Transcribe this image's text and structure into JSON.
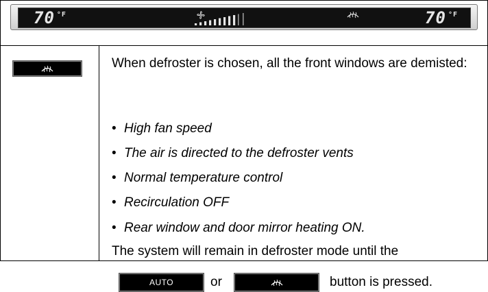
{
  "display": {
    "left_temp": "70",
    "right_temp": "70",
    "unit": "°F",
    "fan_level_bars": 9,
    "fan_total_bars": 11
  },
  "icons": {
    "defroster": "windshield-defroster-icon",
    "fan": "fan-icon"
  },
  "text": {
    "intro": "When defroster is chosen, all the front windows are demisted:",
    "bullets": [
      "High fan speed",
      "The air is directed to the defroster vents",
      "Normal temperature control",
      "Recirculation OFF",
      "Rear window and door mirror heating ON."
    ],
    "remain": "The system will remain in defroster mode until the",
    "auto_label": "AUTO",
    "or": "or",
    "pressed": "button is pressed."
  }
}
